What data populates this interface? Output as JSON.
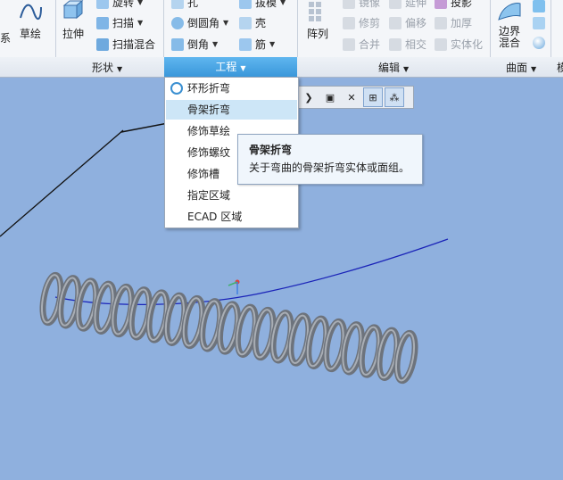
{
  "ribbon": {
    "left_cut": "系",
    "sketch": "草绘",
    "extrude": "拉伸",
    "revolve": "旋转",
    "sweep": "扫描",
    "swept_blend": "扫描混合",
    "hole": "孔",
    "round": "倒圆角",
    "chamfer": "倒角",
    "draft": "拔模",
    "shell": "壳",
    "rib": "筋",
    "pattern": "阵列",
    "mirror": "镜像",
    "trim": "修剪",
    "merge": "合并",
    "extend": "延伸",
    "offset": "偏移",
    "intersect": "相交",
    "project": "投影",
    "thicken": "加厚",
    "solidify": "实体化",
    "boundary_blend": "边界混合"
  },
  "groups": {
    "shape": "形状",
    "engineering": "工程",
    "editing": "编辑",
    "surfaces": "曲面",
    "right_cut": "模"
  },
  "menu": {
    "items": [
      "环形折弯",
      "骨架折弯",
      "修饰草绘",
      "修饰螺纹",
      "修饰槽",
      "指定区域",
      "ECAD 区域"
    ]
  },
  "tooltip": {
    "title": "骨架折弯",
    "desc": "关于弯曲的骨架折弯实体或面组。"
  },
  "colors": {
    "viewport": "#8fb0de",
    "accent": "#3a97da",
    "highlight": "#cde6f7"
  }
}
